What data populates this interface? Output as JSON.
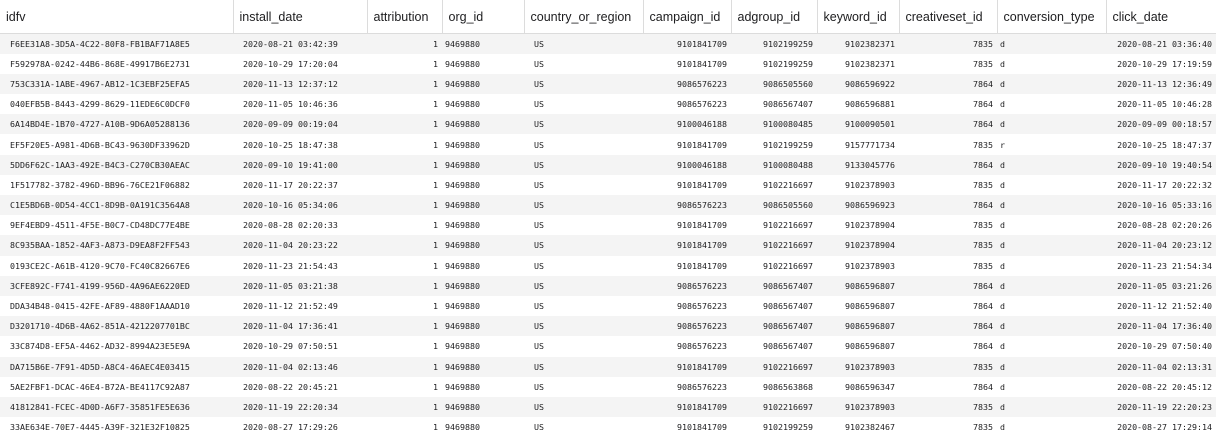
{
  "table": {
    "columns": [
      "idfv",
      "install_date",
      "attribution",
      "org_id",
      "country_or_region",
      "campaign_id",
      "adgroup_id",
      "keyword_id",
      "creativeset_id",
      "conversion_type",
      "click_date"
    ],
    "rows": [
      [
        "F6EE31A8-3D5A-4C22-80F8-FB1BAF71A8E5",
        "2020-08-21 03:42:39",
        "1",
        "9469880",
        "US",
        "9101841709",
        "9102199259",
        "9102382371",
        "7835",
        "d",
        "2020-08-21 03:36:40"
      ],
      [
        "F592978A-0242-44B6-868E-49917B6E2731",
        "2020-10-29 17:20:04",
        "1",
        "9469880",
        "US",
        "9101841709",
        "9102199259",
        "9102382371",
        "7835",
        "d",
        "2020-10-29 17:19:59"
      ],
      [
        "753C331A-1ABE-4967-AB12-1C3EBF25EFA5",
        "2020-11-13 12:37:12",
        "1",
        "9469880",
        "US",
        "9086576223",
        "9086505560",
        "9086596922",
        "7864",
        "d",
        "2020-11-13 12:36:49"
      ],
      [
        "040EFB5B-8443-4299-8629-11EDE6C0DCF0",
        "2020-11-05 10:46:36",
        "1",
        "9469880",
        "US",
        "9086576223",
        "9086567407",
        "9086596881",
        "7864",
        "d",
        "2020-11-05 10:46:28"
      ],
      [
        "6A14BD4E-1B70-4727-A10B-9D6A05288136",
        "2020-09-09 00:19:04",
        "1",
        "9469880",
        "US",
        "9100046188",
        "9100080485",
        "9100090501",
        "7864",
        "d",
        "2020-09-09 00:18:57"
      ],
      [
        "EF5F20E5-A981-4D6B-BC43-9630DF33962D",
        "2020-10-25 18:47:38",
        "1",
        "9469880",
        "US",
        "9101841709",
        "9102199259",
        "9157771734",
        "7835",
        "r",
        "2020-10-25 18:47:37"
      ],
      [
        "5DD6F62C-1AA3-492E-B4C3-C270CB30AEAC",
        "2020-09-10 19:41:00",
        "1",
        "9469880",
        "US",
        "9100046188",
        "9100080488",
        "9133045776",
        "7864",
        "d",
        "2020-09-10 19:40:54"
      ],
      [
        "1F517782-3782-496D-BB96-76CE21F06882",
        "2020-11-17 20:22:37",
        "1",
        "9469880",
        "US",
        "9101841709",
        "9102216697",
        "9102378903",
        "7835",
        "d",
        "2020-11-17 20:22:32"
      ],
      [
        "C1E5BD6B-0D54-4CC1-8D9B-0A191C3564A8",
        "2020-10-16 05:34:06",
        "1",
        "9469880",
        "US",
        "9086576223",
        "9086505560",
        "9086596923",
        "7864",
        "d",
        "2020-10-16 05:33:16"
      ],
      [
        "9EF4EBD9-4511-4F5E-B0C7-CD48DC77E4BE",
        "2020-08-28 02:20:33",
        "1",
        "9469880",
        "US",
        "9101841709",
        "9102216697",
        "9102378904",
        "7835",
        "d",
        "2020-08-28 02:20:26"
      ],
      [
        "8C935BAA-1852-4AF3-A873-D9EA8F2FF543",
        "2020-11-04 20:23:22",
        "1",
        "9469880",
        "US",
        "9101841709",
        "9102216697",
        "9102378904",
        "7835",
        "d",
        "2020-11-04 20:23:12"
      ],
      [
        "0193CE2C-A61B-4120-9C70-FC40C82667E6",
        "2020-11-23 21:54:43",
        "1",
        "9469880",
        "US",
        "9101841709",
        "9102216697",
        "9102378903",
        "7835",
        "d",
        "2020-11-23 21:54:34"
      ],
      [
        "3CFE892C-F741-4199-956D-4A96AE6220ED",
        "2020-11-05 03:21:38",
        "1",
        "9469880",
        "US",
        "9086576223",
        "9086567407",
        "9086596807",
        "7864",
        "d",
        "2020-11-05 03:21:26"
      ],
      [
        "DDA34B48-0415-42FE-AF89-4880F1AAAD10",
        "2020-11-12 21:52:49",
        "1",
        "9469880",
        "US",
        "9086576223",
        "9086567407",
        "9086596807",
        "7864",
        "d",
        "2020-11-12 21:52:40"
      ],
      [
        "D3201710-4D6B-4A62-851A-4212207701BC",
        "2020-11-04 17:36:41",
        "1",
        "9469880",
        "US",
        "9086576223",
        "9086567407",
        "9086596807",
        "7864",
        "d",
        "2020-11-04 17:36:40"
      ],
      [
        "33C874D8-EF5A-4462-AD32-8994A23E5E9A",
        "2020-10-29 07:50:51",
        "1",
        "9469880",
        "US",
        "9086576223",
        "9086567407",
        "9086596807",
        "7864",
        "d",
        "2020-10-29 07:50:40"
      ],
      [
        "DA715B6E-7F91-4D5D-A8C4-46AEC4E03415",
        "2020-11-04 02:13:46",
        "1",
        "9469880",
        "US",
        "9101841709",
        "9102216697",
        "9102378903",
        "7835",
        "d",
        "2020-11-04 02:13:31"
      ],
      [
        "5AE2FBF1-DCAC-46E4-B72A-BE4117C92A87",
        "2020-08-22 20:45:21",
        "1",
        "9469880",
        "US",
        "9086576223",
        "9086563868",
        "9086596347",
        "7864",
        "d",
        "2020-08-22 20:45:12"
      ],
      [
        "41812841-FCEC-4D0D-A6F7-35851FE5E636",
        "2020-11-19 22:20:34",
        "1",
        "9469880",
        "US",
        "9101841709",
        "9102216697",
        "9102378903",
        "7835",
        "d",
        "2020-11-19 22:20:23"
      ],
      [
        "33AE634E-70E7-4445-A39F-321E32F10825",
        "2020-08-27 17:29:26",
        "1",
        "9469880",
        "US",
        "9101841709",
        "9102199259",
        "9102382467",
        "7835",
        "d",
        "2020-08-27 17:29:14"
      ]
    ]
  }
}
